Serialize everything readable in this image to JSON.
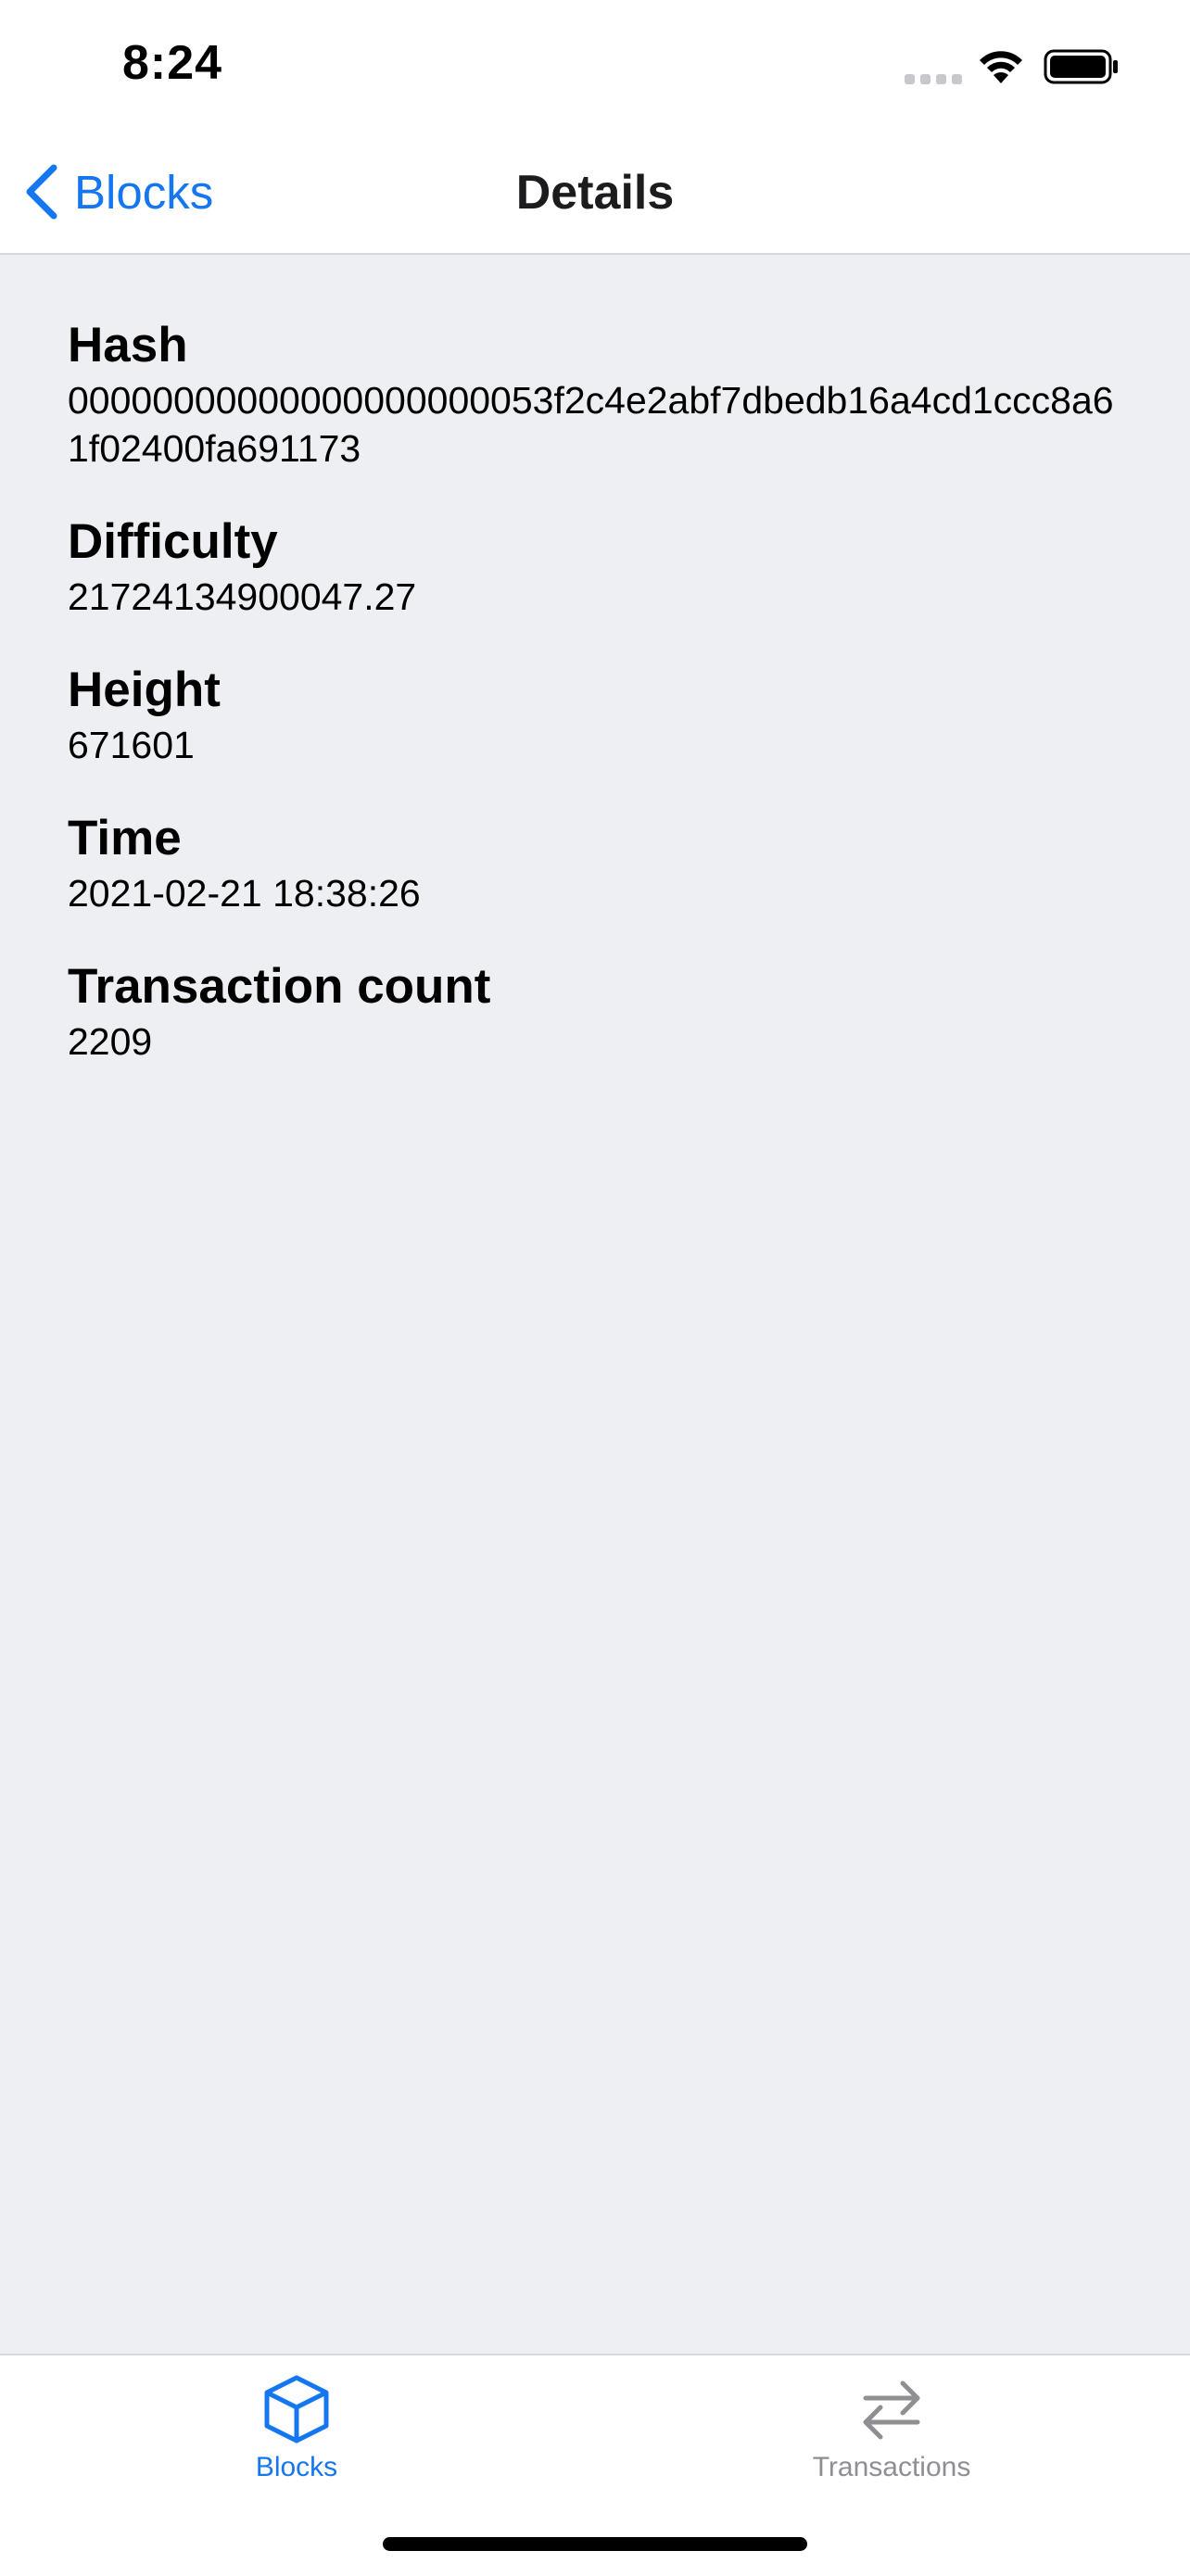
{
  "status_bar": {
    "time": "8:24"
  },
  "nav": {
    "back_label": "Blocks",
    "title": "Details"
  },
  "details": [
    {
      "label": "Hash",
      "value": "00000000000000000000053f2c4e2abf7dbedb16a4cd1ccc8a61f02400fa691173"
    },
    {
      "label": "Difficulty",
      "value": "21724134900047.27"
    },
    {
      "label": "Height",
      "value": "671601"
    },
    {
      "label": "Time",
      "value": "2021-02-21 18:38:26"
    },
    {
      "label": "Transaction count",
      "value": "2209"
    }
  ],
  "tabs": [
    {
      "label": "Blocks",
      "icon": "cube-icon",
      "selected": true
    },
    {
      "label": "Transactions",
      "icon": "arrows-swap-icon",
      "selected": false
    }
  ],
  "colors": {
    "accent": "#1477f0",
    "background": "#eeeff3",
    "inactive_tab": "#8e8e93"
  }
}
